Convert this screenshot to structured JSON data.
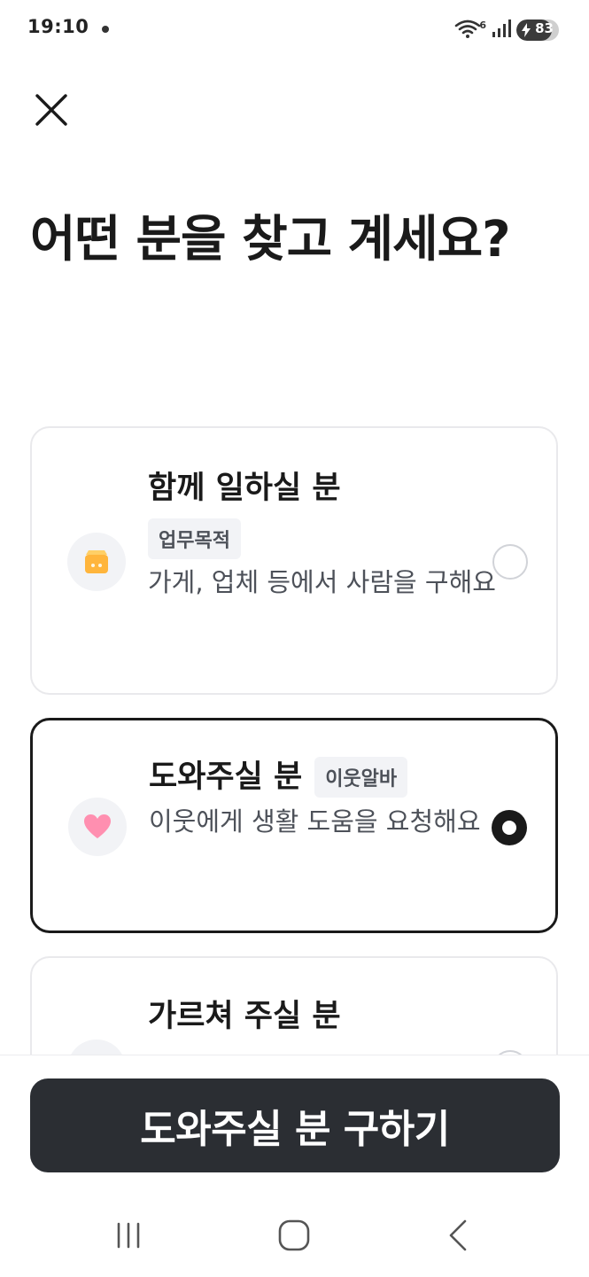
{
  "status_bar": {
    "time": "19:10",
    "network_label": "6",
    "battery_level": 83,
    "battery_text": "83"
  },
  "header": {
    "close_icon": "close-icon",
    "title": "어떤 분을 찾고 계세요?"
  },
  "options": [
    {
      "title": "함께 일하실 분",
      "badge": "업무목적",
      "description": "가게, 업체 등에서 사람을 구해요",
      "icon": "store-icon",
      "icon_color": "#ffb53c",
      "selected": false
    },
    {
      "title": "도와주실 분",
      "badge": "이웃알바",
      "description": "이웃에게 생활 도움을 요청해요",
      "icon": "heart-icon",
      "icon_color": "#ff8fb0",
      "selected": true
    },
    {
      "title": "가르쳐 주실 분",
      "selected": false
    }
  ],
  "cta": {
    "label": "도와주실 분 구하기",
    "background": "#2b2e33"
  },
  "nav_bar": {
    "icons": [
      "recents-icon",
      "home-icon",
      "back-icon"
    ]
  }
}
